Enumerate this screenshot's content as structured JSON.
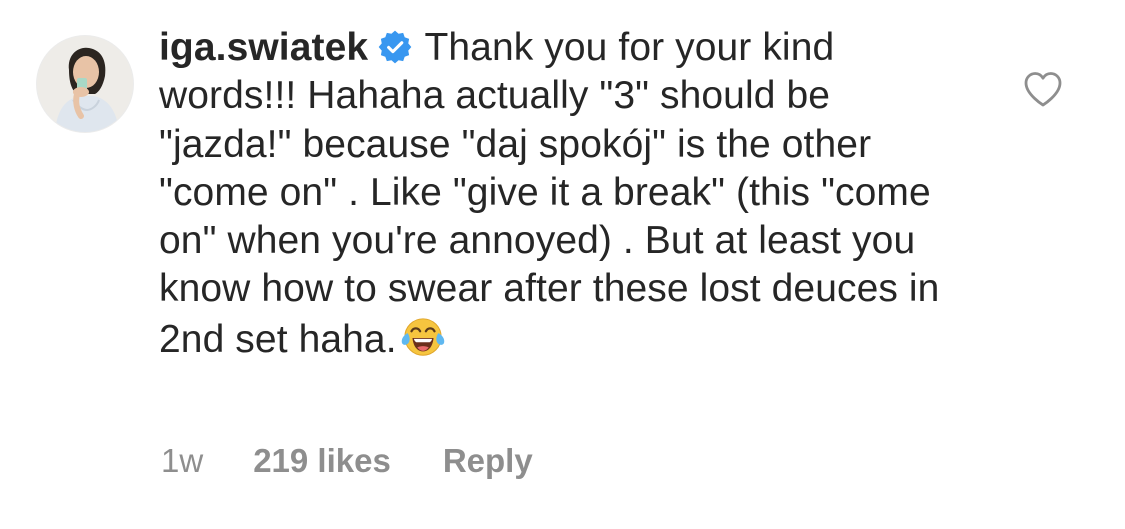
{
  "comment": {
    "username": "iga.swiatek",
    "text": "Thank you for your kind words!!! Hahaha actually \"3\" should be \"jazda!\" because \"daj spokój\" is the other \"come on\" . Like \"give it a break\" (this \"come on\" when you're annoyed) . But at least you know how to swear after these lost deuces in 2nd set haha.",
    "time": "1w",
    "likes": "219 likes",
    "reply_label": "Reply"
  },
  "icons": {
    "verified": "verified-badge-icon",
    "emoji": "face-with-tears-of-joy-emoji",
    "like": "heart-outline-icon"
  },
  "colors": {
    "verified_blue": "#3897f0",
    "meta_gray": "#8e8e8e",
    "text": "#262626"
  }
}
